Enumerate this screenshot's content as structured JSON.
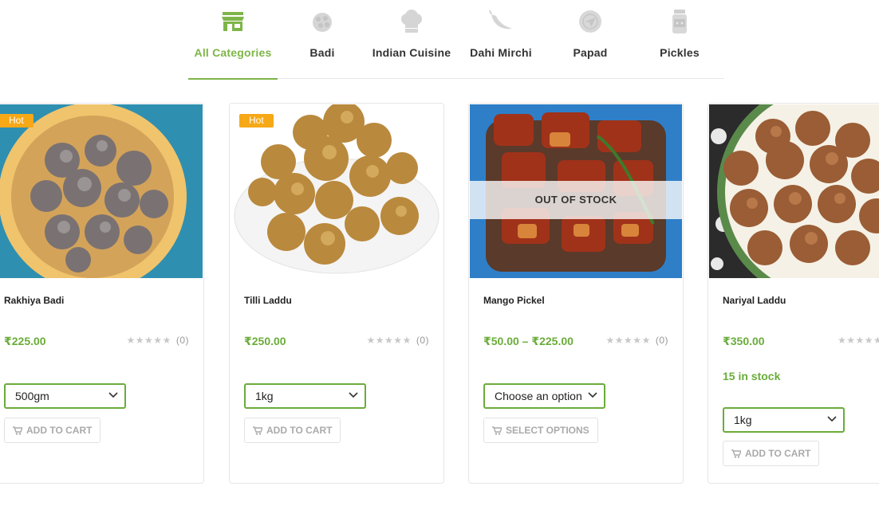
{
  "categories": [
    {
      "label": "All Categories",
      "icon": "store-icon",
      "active": true
    },
    {
      "label": "Badi",
      "icon": "badi-icon",
      "active": false
    },
    {
      "label": "Indian Cuisine",
      "icon": "chef-hat-icon",
      "active": false
    },
    {
      "label": "Dahi Mirchi",
      "icon": "chili-icon",
      "active": false
    },
    {
      "label": "Papad",
      "icon": "papad-icon",
      "active": false
    },
    {
      "label": "Pickles",
      "icon": "pickle-jar-icon",
      "active": false
    }
  ],
  "colors": {
    "accent": "#7eb548",
    "price": "#6aac3a",
    "badge": "#f6a817"
  },
  "products": [
    {
      "name": "Rakhiya Badi",
      "badge": "Hot",
      "price": "₹225.00",
      "rating_count": "(0)",
      "select_value": "500gm",
      "button_label": "ADD TO CART"
    },
    {
      "name": "Tilli Laddu",
      "badge": "Hot",
      "price": "₹250.00",
      "rating_count": "(0)",
      "select_value": "1kg",
      "button_label": "ADD TO CART"
    },
    {
      "name": "Mango Pickel",
      "overlay": "OUT OF STOCK",
      "price": "₹50.00 – ₹225.00",
      "rating_count": "(0)",
      "select_value": "Choose an option",
      "button_label": "SELECT OPTIONS"
    },
    {
      "name": "Nariyal Laddu",
      "price": "₹350.00",
      "stock": "15 in stock",
      "select_value": "1kg",
      "button_label": "ADD TO CART"
    }
  ]
}
